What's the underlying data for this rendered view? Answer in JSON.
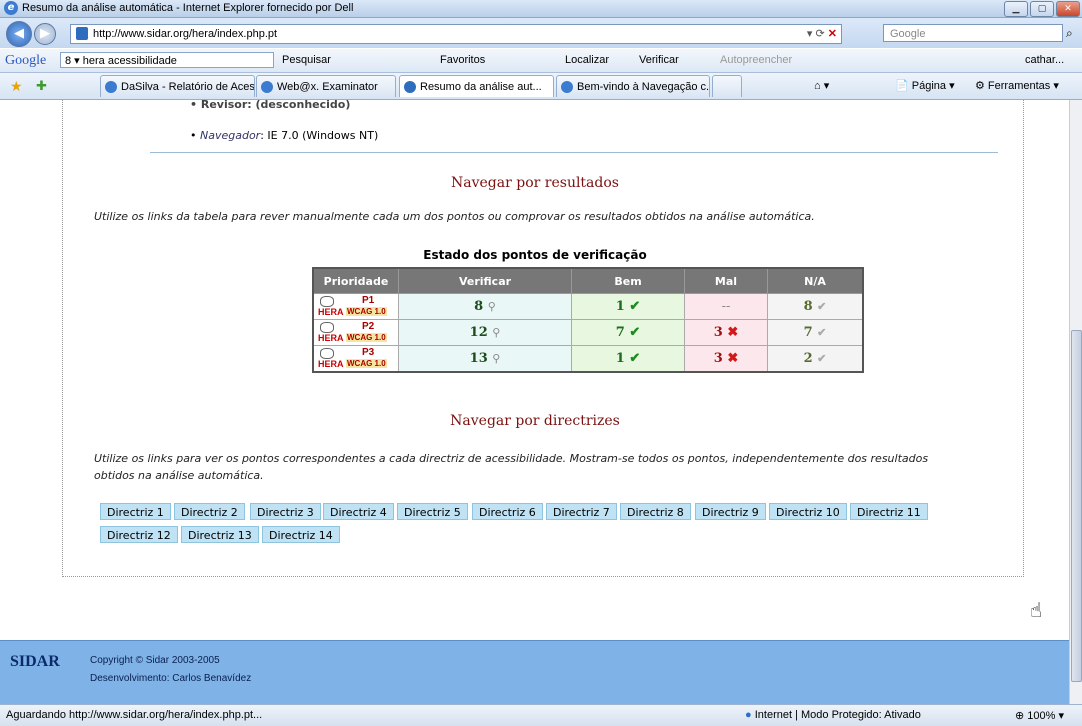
{
  "window": {
    "title": "Resumo da análise automática - Internet Explorer fornecido por Dell",
    "url": "http://www.sidar.org/hera/index.php.pt",
    "search_placeholder": "Google"
  },
  "google_toolbar": {
    "logo": "Google",
    "query": "8 ▾ hera acessibilidade",
    "search_label": "Pesquisar",
    "favorites_label": "Favoritos",
    "find_label": "Localizar",
    "check_label": "Verificar",
    "autofill_label": "Autopreencher",
    "user": "cathar..."
  },
  "tabs": [
    {
      "label": "DaSilva - Relatório de Aces..."
    },
    {
      "label": "Web@x. Examinator"
    },
    {
      "label": "Resumo da análise aut..."
    },
    {
      "label": "Bem-vindo à Navegação c..."
    }
  ],
  "commands": {
    "page": "Página",
    "tools": "Ferramentas"
  },
  "page": {
    "bullet_cut": "Revisor: (desconhecido)",
    "bullet_browser_label": "Navegador",
    "bullet_browser_value": ": IE 7.0 (Windows NT)",
    "section1_title": "Navegar por resultados",
    "section1_text": "Utilize os links da tabela para rever manualmente cada um dos pontos ou comprovar os resultados obtidos na análise automática.",
    "table_caption": "Estado dos pontos de verificação",
    "table_headers": [
      "Prioridade",
      "Verificar",
      "Bem",
      "Mal",
      "N/A"
    ],
    "rows": [
      {
        "priority": "P1",
        "wcag": "WCAG 1.0",
        "verificar": "8",
        "bem": "1",
        "mal": "--",
        "na": "8"
      },
      {
        "priority": "P2",
        "wcag": "WCAG 1.0",
        "verificar": "12",
        "bem": "7",
        "mal": "3",
        "na": "7"
      },
      {
        "priority": "P3",
        "wcag": "WCAG 1.0",
        "verificar": "13",
        "bem": "1",
        "mal": "3",
        "na": "2"
      }
    ],
    "logo_text": "HERA",
    "section2_title": "Navegar por directrizes",
    "section2_text_1": "Utilize os links para ver os pontos correspondentes a cada directriz de acessibilidade. Mostram-se todos os pontos, independentemente dos resultados",
    "section2_text_2": "obtidos na análise automática.",
    "directrizes": [
      "Directriz 1",
      "Directriz 2",
      "Directriz 3",
      "Directriz 4",
      "Directriz 5",
      "Directriz 6",
      "Directriz 7",
      "Directriz 8",
      "Directriz 9",
      "Directriz 10",
      "Directriz 11",
      "Directriz 12",
      "Directriz 13",
      "Directriz 14"
    ]
  },
  "footer": {
    "logo": "SIDAR",
    "copyright": "Copyright © Sidar 2003-2005",
    "dev": "Desenvolvimento: Carlos Benavídez"
  },
  "status": {
    "left": "Aguardando http://www.sidar.org/hera/index.php.pt...",
    "zone": "Internet | Modo Protegido: Ativado",
    "zoom": "100%"
  }
}
